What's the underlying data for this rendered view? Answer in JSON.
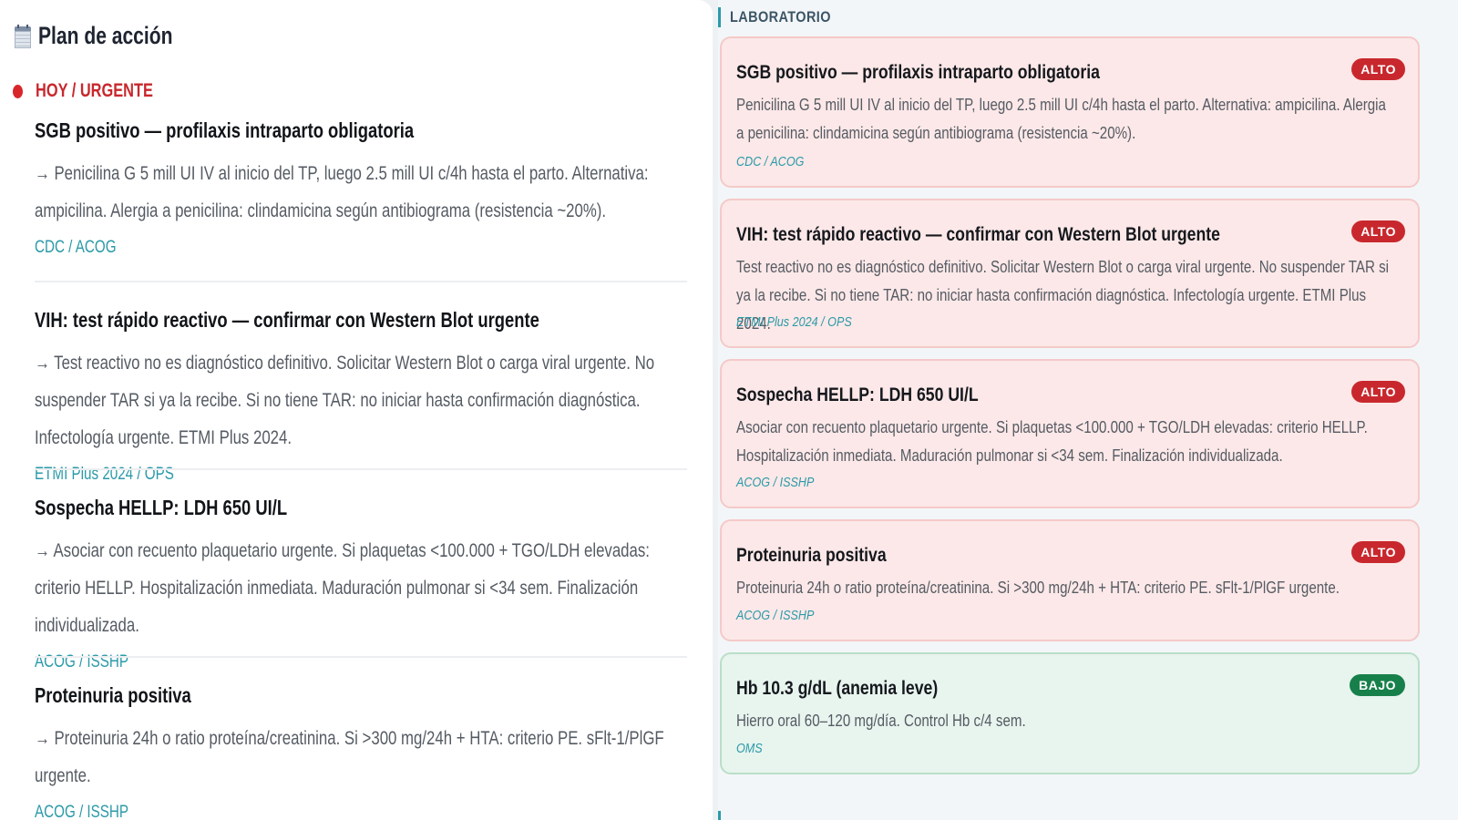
{
  "plan": {
    "title": "Plan de acción",
    "icon": "calendar-icon",
    "section_label": "HOY / URGENTE",
    "items": [
      {
        "title": "SGB positivo — profilaxis intraparto obligatoria",
        "description": "→ Penicilina G 5 mill UI IV al inicio del TP, luego 2.5 mill UI c/4h hasta el parto. Alternativa: ampicilina. Alergia a penicilina: clindamicina según antibiograma (resistencia ~20%).",
        "source": "CDC / ACOG"
      },
      {
        "title": "VIH: test rápido reactivo — confirmar con Western Blot urgente",
        "description": "→ Test reactivo no es diagnóstico definitivo. Solicitar Western Blot o carga viral urgente. No suspender TAR si ya la recibe. Si no tiene TAR: no iniciar hasta confirmación diagnóstica. Infectología urgente. ETMI Plus 2024.",
        "source": "ETMI Plus 2024 / OPS"
      },
      {
        "title": "Sospecha HELLP: LDH 650 UI/L",
        "description": "→ Asociar con recuento plaquetario urgente. Si plaquetas <100.000 + TGO/LDH elevadas: criterio HELLP. Hospitalización inmediata. Maduración pulmonar si <34 sem. Finalización individualizada.",
        "source": "ACOG / ISSHP"
      },
      {
        "title": "Proteinuria positiva",
        "description": "→ Proteinuria 24h o ratio proteína/creatinina. Si >300 mg/24h + HTA: criterio PE. sFlt-1/PlGF urgente.",
        "source": "ACOG / ISSHP"
      }
    ]
  },
  "lab": {
    "section_label": "LABORATORIO",
    "cards": [
      {
        "title": "SGB positivo — profilaxis intraparto obligatoria",
        "description": "Penicilina G 5 mill UI IV al inicio del TP, luego 2.5 mill UI c/4h hasta el parto. Alternativa: ampicilina. Alergia a penicilina: clindamicina según antibiograma (resistencia ~20%).",
        "source": "CDC / ACOG",
        "badge": "ALTO",
        "level": "alto"
      },
      {
        "title": "VIH: test rápido reactivo — confirmar con Western Blot urgente",
        "description": "Test reactivo no es diagnóstico definitivo. Solicitar Western Blot o carga viral urgente. No suspender TAR si ya la recibe. Si no tiene TAR: no iniciar hasta confirmación diagnóstica. Infectología urgente. ETMI Plus 2024.",
        "source": "ETMI Plus 2024 / OPS",
        "badge": "ALTO",
        "level": "alto"
      },
      {
        "title": "Sospecha HELLP: LDH 650 UI/L",
        "description": "Asociar con recuento plaquetario urgente. Si plaquetas <100.000 + TGO/LDH elevadas: criterio HELLP. Hospitalización inmediata. Maduración pulmonar si <34 sem. Finalización individualizada.",
        "source": "ACOG / ISSHP",
        "badge": "ALTO",
        "level": "alto"
      },
      {
        "title": "Proteinuria positiva",
        "description": "Proteinuria 24h o ratio proteína/creatinina. Si >300 mg/24h + HTA: criterio PE. sFlt-1/PlGF urgente.",
        "source": "ACOG / ISSHP",
        "badge": "ALTO",
        "level": "alto"
      },
      {
        "title": "Hb 10.3 g/dL (anemia leve)",
        "description": "Hierro oral 60–120 mg/día. Control Hb c/4 sem.",
        "source": "OMS",
        "badge": "BAJO",
        "level": "bajo"
      }
    ]
  },
  "colors": {
    "urgent_red": "#c8282d",
    "source_teal": "#2a9aa8",
    "alto_bg": "#fce8e8",
    "bajo_bg": "#e8f4ee",
    "bajo_green": "#17804a"
  }
}
